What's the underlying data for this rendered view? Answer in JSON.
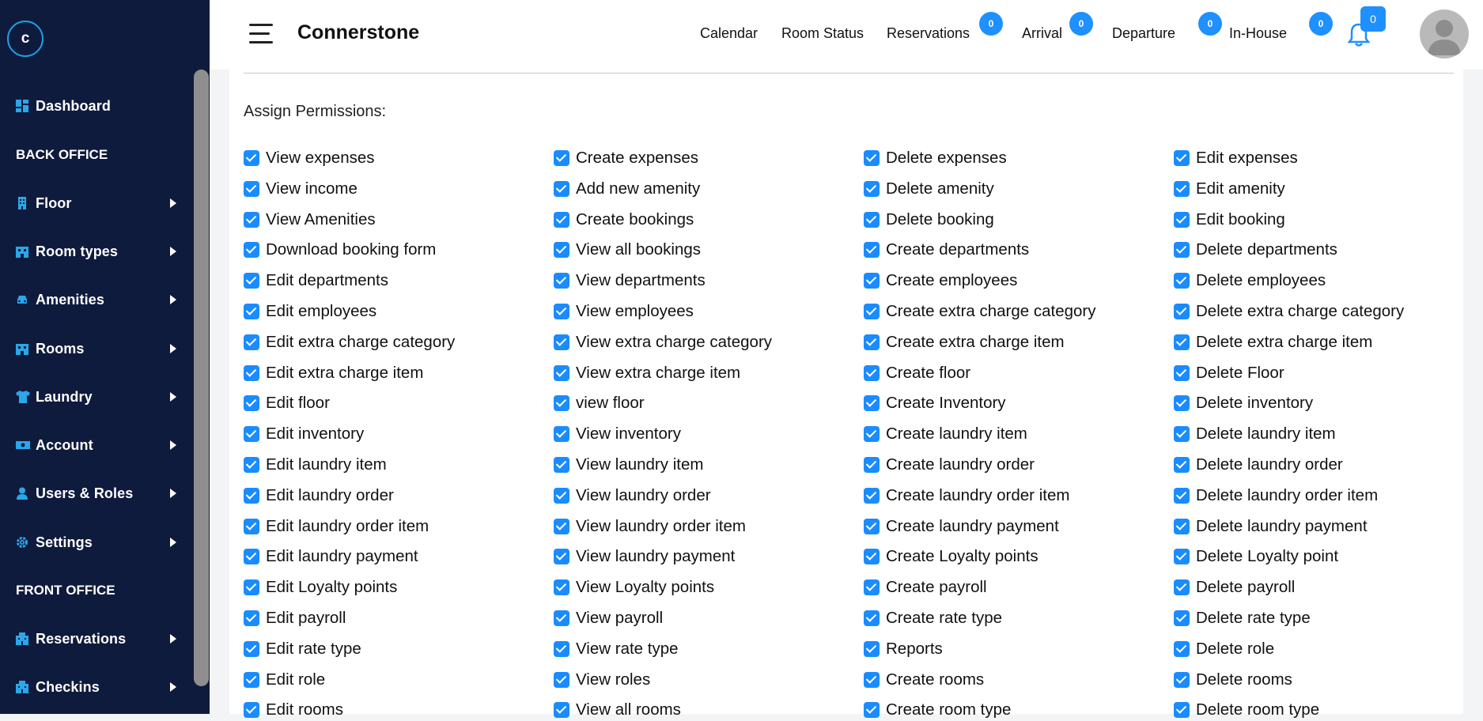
{
  "app": {
    "logo_letter": "c",
    "brand": "Connerstone"
  },
  "sidebar": {
    "dashboard": "Dashboard",
    "back_office": "BACK OFFICE",
    "floor": "Floor",
    "room_types": "Room types",
    "amenities": "Amenities",
    "rooms": "Rooms",
    "laundry": "Laundry",
    "account": "Account",
    "users_roles": "Users & Roles",
    "settings": "Settings",
    "front_office": "FRONT OFFICE",
    "reservations": "Reservations",
    "checkins": "Checkins"
  },
  "header": {
    "calendar": "Calendar",
    "room_status": "Room Status",
    "reservations": "Reservations",
    "reservations_count": "0",
    "arrival": "Arrival",
    "arrival_count": "0",
    "departure": "Departure",
    "departure_count": "0",
    "in_house": "In-House",
    "in_house_count": "0",
    "notifications_count": "0"
  },
  "colors": {
    "sidebar_bg": "#0f1b3d",
    "accent": "#1e90ff",
    "checkbox": "#1a8cff"
  },
  "permissions": {
    "title": "Assign Permissions:",
    "items": [
      {
        "label": "View expenses",
        "checked": true
      },
      {
        "label": "Create expenses",
        "checked": true
      },
      {
        "label": "Delete expenses",
        "checked": true
      },
      {
        "label": "Edit expenses",
        "checked": true
      },
      {
        "label": "View income",
        "checked": true
      },
      {
        "label": "Add new amenity",
        "checked": true
      },
      {
        "label": "Delete amenity",
        "checked": true
      },
      {
        "label": "Edit amenity",
        "checked": true
      },
      {
        "label": "View Amenities",
        "checked": true
      },
      {
        "label": "Create bookings",
        "checked": true
      },
      {
        "label": "Delete booking",
        "checked": true
      },
      {
        "label": "Edit booking",
        "checked": true
      },
      {
        "label": "Download booking form",
        "checked": true
      },
      {
        "label": "View all bookings",
        "checked": true
      },
      {
        "label": "Create departments",
        "checked": true
      },
      {
        "label": "Delete departments",
        "checked": true
      },
      {
        "label": "Edit departments",
        "checked": true
      },
      {
        "label": "View departments",
        "checked": true
      },
      {
        "label": "Create employees",
        "checked": true
      },
      {
        "label": "Delete employees",
        "checked": true
      },
      {
        "label": "Edit employees",
        "checked": true
      },
      {
        "label": "View employees",
        "checked": true
      },
      {
        "label": "Create extra charge category",
        "checked": true
      },
      {
        "label": "Delete extra charge category",
        "checked": true
      },
      {
        "label": "Edit extra charge category",
        "checked": true
      },
      {
        "label": "View extra charge category",
        "checked": true
      },
      {
        "label": "Create extra charge item",
        "checked": true
      },
      {
        "label": "Delete extra charge item",
        "checked": true
      },
      {
        "label": "Edit extra charge item",
        "checked": true
      },
      {
        "label": "View extra charge item",
        "checked": true
      },
      {
        "label": "Create floor",
        "checked": true
      },
      {
        "label": "Delete Floor",
        "checked": true
      },
      {
        "label": "Edit floor",
        "checked": true
      },
      {
        "label": "view floor",
        "checked": true
      },
      {
        "label": "Create Inventory",
        "checked": true
      },
      {
        "label": "Delete inventory",
        "checked": true
      },
      {
        "label": "Edit inventory",
        "checked": true
      },
      {
        "label": "View inventory",
        "checked": true
      },
      {
        "label": "Create laundry item",
        "checked": true
      },
      {
        "label": "Delete laundry item",
        "checked": true
      },
      {
        "label": "Edit laundry item",
        "checked": true
      },
      {
        "label": "View laundry item",
        "checked": true
      },
      {
        "label": "Create laundry order",
        "checked": true
      },
      {
        "label": "Delete laundry order",
        "checked": true
      },
      {
        "label": "Edit laundry order",
        "checked": true
      },
      {
        "label": "View laundry order",
        "checked": true
      },
      {
        "label": "Create laundry order item",
        "checked": true
      },
      {
        "label": "Delete laundry order item",
        "checked": true
      },
      {
        "label": "Edit laundry order item",
        "checked": true
      },
      {
        "label": "View laundry order item",
        "checked": true
      },
      {
        "label": "Create laundry payment",
        "checked": true
      },
      {
        "label": "Delete laundry payment",
        "checked": true
      },
      {
        "label": "Edit laundry payment",
        "checked": true
      },
      {
        "label": "View laundry payment",
        "checked": true
      },
      {
        "label": "Create Loyalty points",
        "checked": true
      },
      {
        "label": "Delete Loyalty point",
        "checked": true
      },
      {
        "label": "Edit Loyalty points",
        "checked": true
      },
      {
        "label": "View Loyalty points",
        "checked": true
      },
      {
        "label": "Create payroll",
        "checked": true
      },
      {
        "label": "Delete payroll",
        "checked": true
      },
      {
        "label": "Edit payroll",
        "checked": true
      },
      {
        "label": "View payroll",
        "checked": true
      },
      {
        "label": "Create rate type",
        "checked": true
      },
      {
        "label": "Delete rate type",
        "checked": true
      },
      {
        "label": "Edit rate type",
        "checked": true
      },
      {
        "label": "View rate type",
        "checked": true
      },
      {
        "label": "Reports",
        "checked": true
      },
      {
        "label": "Delete role",
        "checked": true
      },
      {
        "label": "Edit role",
        "checked": true
      },
      {
        "label": "View roles",
        "checked": true
      },
      {
        "label": "Create rooms",
        "checked": true
      },
      {
        "label": "Delete rooms",
        "checked": true
      },
      {
        "label": "Edit rooms",
        "checked": true
      },
      {
        "label": "View all rooms",
        "checked": true
      },
      {
        "label": "Create room type",
        "checked": true
      },
      {
        "label": "Delete room type",
        "checked": true
      }
    ]
  }
}
